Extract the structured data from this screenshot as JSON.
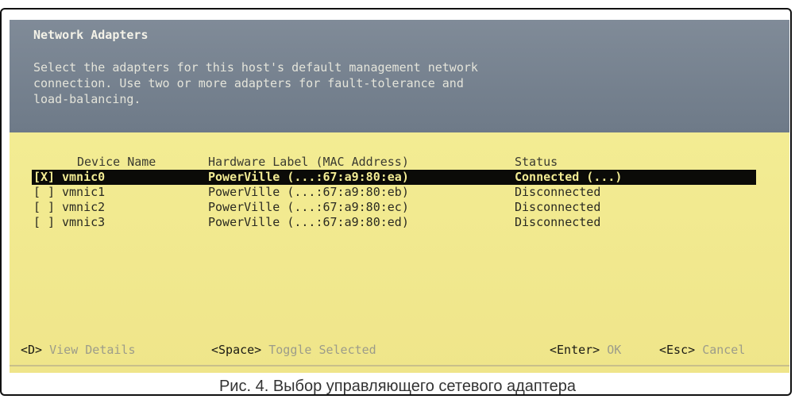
{
  "dialog": {
    "title": "Network Adapters",
    "description_lines": [
      "Select the adapters for this host's default management network",
      "connection. Use two or more adapters for fault-tolerance and",
      "load-balancing."
    ]
  },
  "table": {
    "columns": [
      "Device Name",
      "Hardware Label (MAC Address)",
      "Status"
    ],
    "rows": [
      {
        "checkbox": "[X]",
        "device": "vmnic0",
        "label": "PowerVille (...:67:a9:80:ea)",
        "status": "Connected (...)",
        "selected": true
      },
      {
        "checkbox": "[ ]",
        "device": "vmnic1",
        "label": "PowerVille (...:67:a9:80:eb)",
        "status": "Disconnected",
        "selected": false
      },
      {
        "checkbox": "[ ]",
        "device": "vmnic2",
        "label": "PowerVille (...:67:a9:80:ec)",
        "status": "Disconnected",
        "selected": false
      },
      {
        "checkbox": "[ ]",
        "device": "vmnic3",
        "label": "PowerVille (...:67:a9:80:ed)",
        "status": "Disconnected",
        "selected": false
      }
    ]
  },
  "footer": {
    "view_details_key": "<D>",
    "view_details_label": "View Details",
    "toggle_key": "<Space>",
    "toggle_label": "Toggle Selected",
    "ok_key": "<Enter>",
    "ok_label": "OK",
    "cancel_key": "<Esc>",
    "cancel_label": "Cancel"
  },
  "caption": "Рис. 4. Выбор управляющего сетевого адаптера",
  "colors": {
    "header_bg": "#7a8593",
    "content_bg": "#f1e98e",
    "selection_bg": "#0b0b08"
  }
}
